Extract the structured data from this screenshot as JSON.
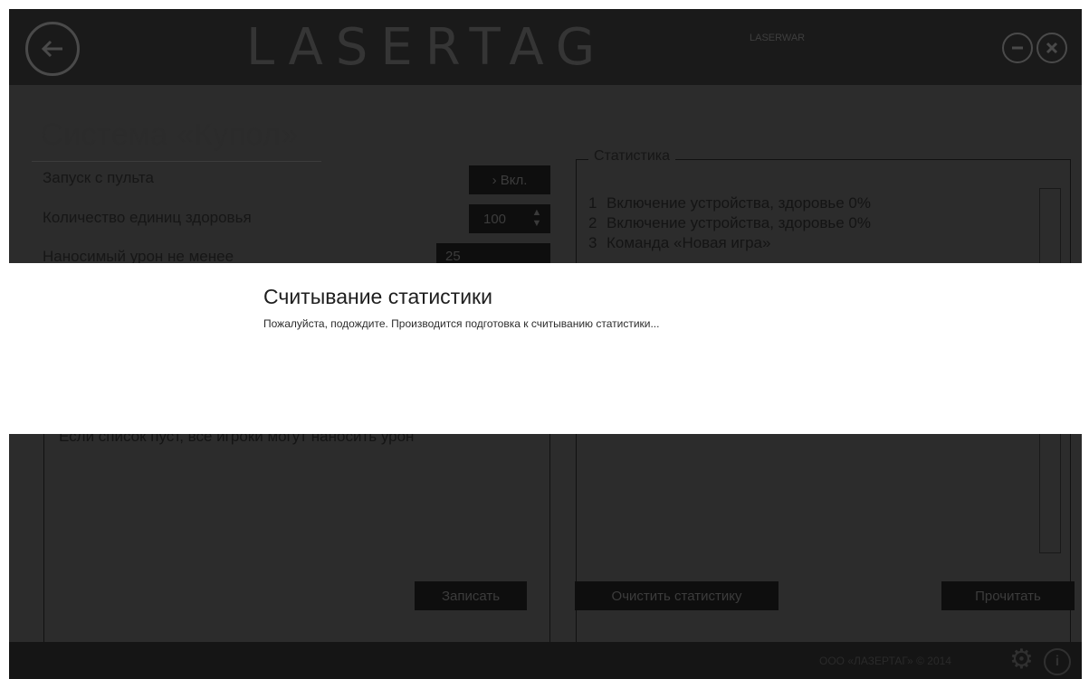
{
  "header": {
    "logo": "LASERTAG",
    "logo_sub": "LASERWAR",
    "back_icon": "arrow-left-icon",
    "minimize_icon": "minus-icon",
    "close_icon": "close-icon"
  },
  "main": {
    "title": "Система «Купол»",
    "rows": [
      {
        "label": "Запуск с пульта",
        "control": "› Вкл."
      },
      {
        "label": "Количество единиц здоровья",
        "control": "100"
      },
      {
        "label": "Наносимый урон не менее",
        "control": "25"
      }
    ],
    "empty_note": "Если список пуст, все игроки могут наносить урон",
    "write_button": "Записать"
  },
  "stats": {
    "legend": "Статистика",
    "items": [
      {
        "num": "1",
        "text": "Включение устройства, здоровье 0%"
      },
      {
        "num": "2",
        "text": "Включение устройства, здоровье 0%"
      },
      {
        "num": "3",
        "text": "Команда «Новая игра»"
      }
    ],
    "clear_button": "Очистить статистику",
    "read_button": "Прочитать"
  },
  "footer": {
    "copyright": "ООО «ЛАЗЕРТАГ» © 2014",
    "gear_icon": "gear-icon",
    "info_icon": "info-icon"
  },
  "modal": {
    "title": "Считывание статистики",
    "message": "Пожалуйста, подождите. Производится подготовка к считыванию статистики..."
  }
}
